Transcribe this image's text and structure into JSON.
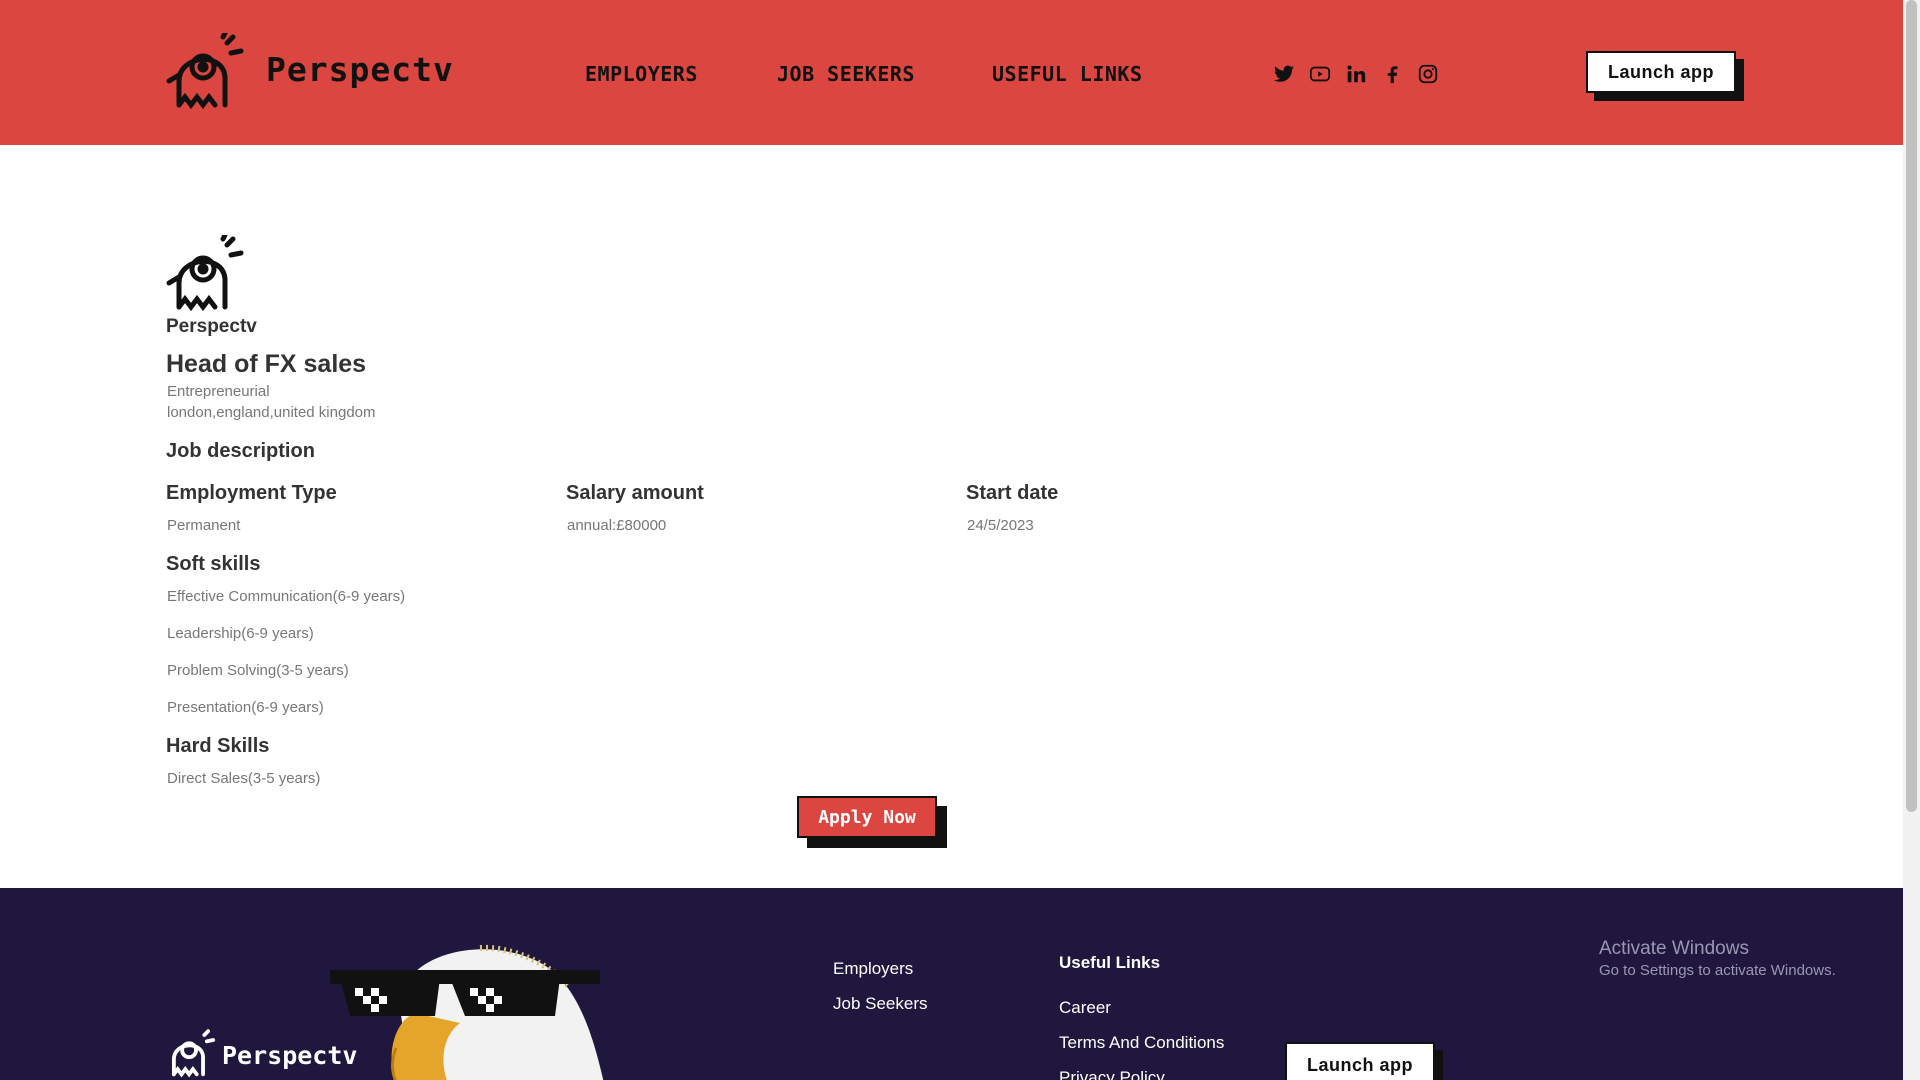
{
  "brand": {
    "name": "Perspectv"
  },
  "header": {
    "nav": [
      "EMPLOYERS",
      "JOB SEEKERS",
      "USEFUL LINKS"
    ],
    "social": [
      "twitter-icon",
      "youtube-icon",
      "linkedin-icon",
      "facebook-icon",
      "instagram-icon"
    ],
    "launch_label": "Launch app"
  },
  "job": {
    "company": "Perspectv",
    "title": "Head of FX sales",
    "category": "Entrepreneurial",
    "location": "london,england,united kingdom",
    "description_heading": "Job description",
    "employment_type_heading": "Employment Type",
    "employment_type": "Permanent",
    "salary_heading": "Salary amount",
    "salary": "annual:£80000",
    "start_heading": "Start date",
    "start_date": "24/5/2023",
    "soft_skills_heading": "Soft skills",
    "soft_skills": [
      "Effective Communication(6-9 years)",
      "Leadership(6-9 years)",
      "Problem Solving(3-5 years)",
      "Presentation(6-9 years)"
    ],
    "hard_skills_heading": "Hard Skills",
    "hard_skills": [
      "Direct Sales(3-5 years)"
    ],
    "apply_label": "Apply Now"
  },
  "footer": {
    "brand": "Perspectv",
    "links": [
      "Employers",
      "Job Seekers"
    ],
    "useful_heading": "Useful Links",
    "useful_links": [
      "Career",
      "Terms And Conditions",
      "Privacy Policy"
    ],
    "launch_label": "Launch app"
  },
  "watermark": {
    "line1": "Activate Windows",
    "line2": "Go to Settings to activate Windows."
  },
  "colors": {
    "header_bg": "#db4640",
    "footer_bg": "#20173f",
    "accent": "#db4640"
  }
}
